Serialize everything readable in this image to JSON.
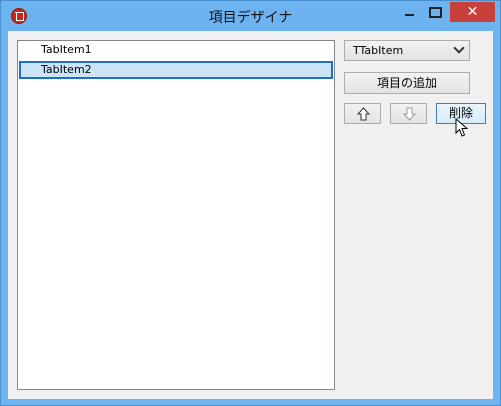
{
  "window": {
    "title": "項目デザイナ"
  },
  "list": {
    "items": [
      {
        "label": "TabItem1",
        "selected": false
      },
      {
        "label": "TabItem2",
        "selected": true
      }
    ]
  },
  "class_select": {
    "value": "TTabItem"
  },
  "buttons": {
    "add_label": "項目の追加",
    "delete_label": "削除"
  },
  "icons": {
    "app": "delphi-icon",
    "move_up": "arrow-up-icon",
    "move_down": "arrow-down-icon",
    "cursor": "mouse-pointer-icon"
  },
  "colors": {
    "titlebar": "#6db3f0",
    "close": "#c7413a",
    "selection_border": "#1e6fc9",
    "selection_fill": "#cce4f7"
  }
}
